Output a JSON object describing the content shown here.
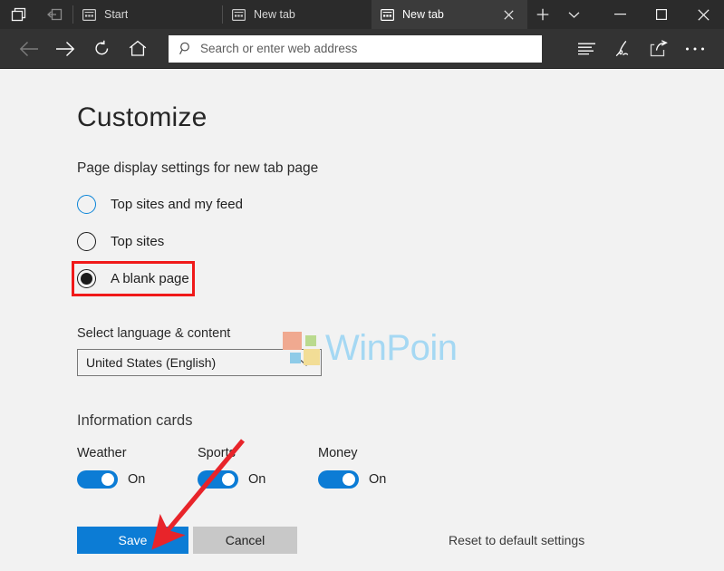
{
  "window": {
    "tabs_aside_icon": "set-tabs-aside-icon",
    "tabs_aside_restore_icon": "restore-tabs-aside-icon",
    "tabs": [
      {
        "title": "Start",
        "active": false,
        "closable": false
      },
      {
        "title": "New tab",
        "active": false,
        "closable": false
      },
      {
        "title": "New tab",
        "active": true,
        "closable": true
      }
    ],
    "new_tab_button": "+",
    "tab_dropdown_button": "chevron-down",
    "controls": {
      "minimize": "minimize",
      "maximize": "maximize",
      "close": "close"
    }
  },
  "toolbar": {
    "back": "back-arrow",
    "forward": "forward-arrow",
    "refresh": "refresh",
    "home": "home",
    "reading_view": "reading-view",
    "add_notes": "add-notes-pen",
    "share": "share",
    "more": "more-ellipsis"
  },
  "address": {
    "value": "",
    "placeholder": "Search or enter web address",
    "icon": "search-icon"
  },
  "content": {
    "heading": "Customize",
    "page_display_label": "Page display settings for new tab page",
    "radio_options": [
      {
        "label": "Top sites and my feed",
        "selected": false,
        "focused": true
      },
      {
        "label": "Top sites",
        "selected": false,
        "focused": false
      },
      {
        "label": "A blank page",
        "selected": true,
        "focused": false,
        "highlighted": true
      }
    ],
    "language_label": "Select language & content",
    "language_value": "United States (English)",
    "language_chevron": "chevron-down-icon",
    "information_cards_title": "Information cards",
    "cards": [
      {
        "name": "Weather",
        "state": "On",
        "enabled": true
      },
      {
        "name": "Sports",
        "state": "On",
        "enabled": true
      },
      {
        "name": "Money",
        "state": "On",
        "enabled": true
      }
    ],
    "save_label": "Save",
    "cancel_label": "Cancel",
    "reset_label": "Reset to default settings"
  },
  "watermark": {
    "text": "WinPoin",
    "text_color": "#a5d8f3",
    "square_colors": {
      "top_left": "#f0a990",
      "top_right": "#bada8e",
      "bottom_left": "#8ecbe8",
      "bottom_right": "#f2dd96"
    }
  },
  "annotations": {
    "highlight_color": "#f01919",
    "arrow_color": "#e8242a",
    "arrow_from": "268,470",
    "arrow_to": "178,578"
  },
  "colors": {
    "titlebar": "#2b2b2b",
    "active_tab": "#3b3b3b",
    "navbar": "#333333",
    "page_background": "#f2f2f2",
    "accent_blue": "#0c7cd5"
  }
}
